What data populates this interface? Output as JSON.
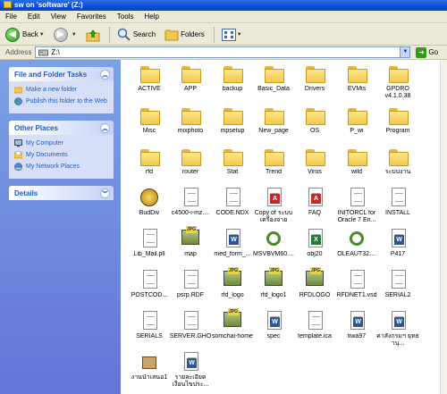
{
  "window": {
    "title": "sw on 'software' (Z:)"
  },
  "menu": [
    "File",
    "Edit",
    "View",
    "Favorites",
    "Tools",
    "Help"
  ],
  "toolbar": {
    "back": "Back",
    "search": "Search",
    "folders": "Folders"
  },
  "address": {
    "label": "Address",
    "value": "Z:\\",
    "go": "Go"
  },
  "left_pane": {
    "file_tasks": {
      "title": "File and Folder Tasks",
      "items": [
        "Make a new folder",
        "Publish this folder to the Web"
      ]
    },
    "other_places": {
      "title": "Other Places",
      "items": [
        "My Computer",
        "My Documents",
        "My Network Places"
      ]
    },
    "details": {
      "title": "Details"
    }
  },
  "items": [
    {
      "label": "ACTIVE",
      "icon": "folder-icon"
    },
    {
      "label": "APP",
      "icon": "folder-icon"
    },
    {
      "label": "backup",
      "icon": "folder-icon"
    },
    {
      "label": "Basic_Data",
      "icon": "folder-icon"
    },
    {
      "label": "Drivers",
      "icon": "folder-icon"
    },
    {
      "label": "EVMis",
      "icon": "folder-icon"
    },
    {
      "label": "GPDRO v4.1.0.38",
      "icon": "folder-icon"
    },
    {
      "label": "Misc",
      "icon": "folder-icon"
    },
    {
      "label": "mixphoto",
      "icon": "folder-icon"
    },
    {
      "label": "mpsetup",
      "icon": "folder-icon"
    },
    {
      "label": "New_page",
      "icon": "folder-icon"
    },
    {
      "label": "OS",
      "icon": "folder-icon"
    },
    {
      "label": "P_wi",
      "icon": "folder-icon"
    },
    {
      "label": "Program",
      "icon": "folder-icon"
    },
    {
      "label": "rfd",
      "icon": "folder-icon"
    },
    {
      "label": "router",
      "icon": "folder-icon"
    },
    {
      "label": "Stat",
      "icon": "folder-icon"
    },
    {
      "label": "Trend",
      "icon": "folder-icon"
    },
    {
      "label": "Virus",
      "icon": "folder-icon"
    },
    {
      "label": "wild",
      "icon": "folder-icon"
    },
    {
      "label": "ระบบงาน",
      "icon": "folder-icon"
    },
    {
      "label": "BudDiv",
      "icon": "coins-icon"
    },
    {
      "label": "c4500-i-mz....",
      "icon": "document-icon"
    },
    {
      "label": "CODE.NDX",
      "icon": "document-icon"
    },
    {
      "label": "Copy of ระบบ เครื่องจ่าย",
      "icon": "pdf-file-icon"
    },
    {
      "label": "FAQ",
      "icon": "pdf-file-icon"
    },
    {
      "label": "INITORCL for Oracle 7 En...",
      "icon": "document-icon"
    },
    {
      "label": "INSTALL",
      "icon": "document-icon"
    },
    {
      "label": "Lib_Mail.pll",
      "icon": "document-icon"
    },
    {
      "label": "map",
      "icon": "jpg-image-icon"
    },
    {
      "label": "med_form_...",
      "icon": "word-document-icon"
    },
    {
      "label": "MSVBVM60....",
      "icon": "setup-gear-icon"
    },
    {
      "label": "obj20",
      "icon": "excel-file-icon"
    },
    {
      "label": "OLEAUT32....",
      "icon": "setup-gear-icon"
    },
    {
      "label": "P417",
      "icon": "word-document-icon"
    },
    {
      "label": "POSTCOD...",
      "icon": "document-icon"
    },
    {
      "label": "psrp.RDF",
      "icon": "document-icon"
    },
    {
      "label": "rfd_logo",
      "icon": "jpg-image-icon"
    },
    {
      "label": "rfd_logo1",
      "icon": "jpg-image-icon"
    },
    {
      "label": "RFDLOGO",
      "icon": "jpg-image-icon"
    },
    {
      "label": "RFDNET1.vsd",
      "icon": "document-icon"
    },
    {
      "label": "SERIAL2",
      "icon": "document-icon"
    },
    {
      "label": "SERIALS",
      "icon": "document-icon"
    },
    {
      "label": "SERVER.GHO",
      "icon": "document-icon"
    },
    {
      "label": "somchai-home",
      "icon": "jpg-image-icon"
    },
    {
      "label": "spec",
      "icon": "word-document-icon"
    },
    {
      "label": "template.ica",
      "icon": "document-icon"
    },
    {
      "label": "tiwa97",
      "icon": "word-document-icon"
    },
    {
      "label": "ค่าสั่งกรมฯ ยุทธานุ...",
      "icon": "word-document-icon"
    },
    {
      "label": "งานนำเสนอ1",
      "icon": "archive-box-icon"
    },
    {
      "label": "รายละเอียด เงื่อนไขประ...",
      "icon": "word-document-icon"
    }
  ]
}
